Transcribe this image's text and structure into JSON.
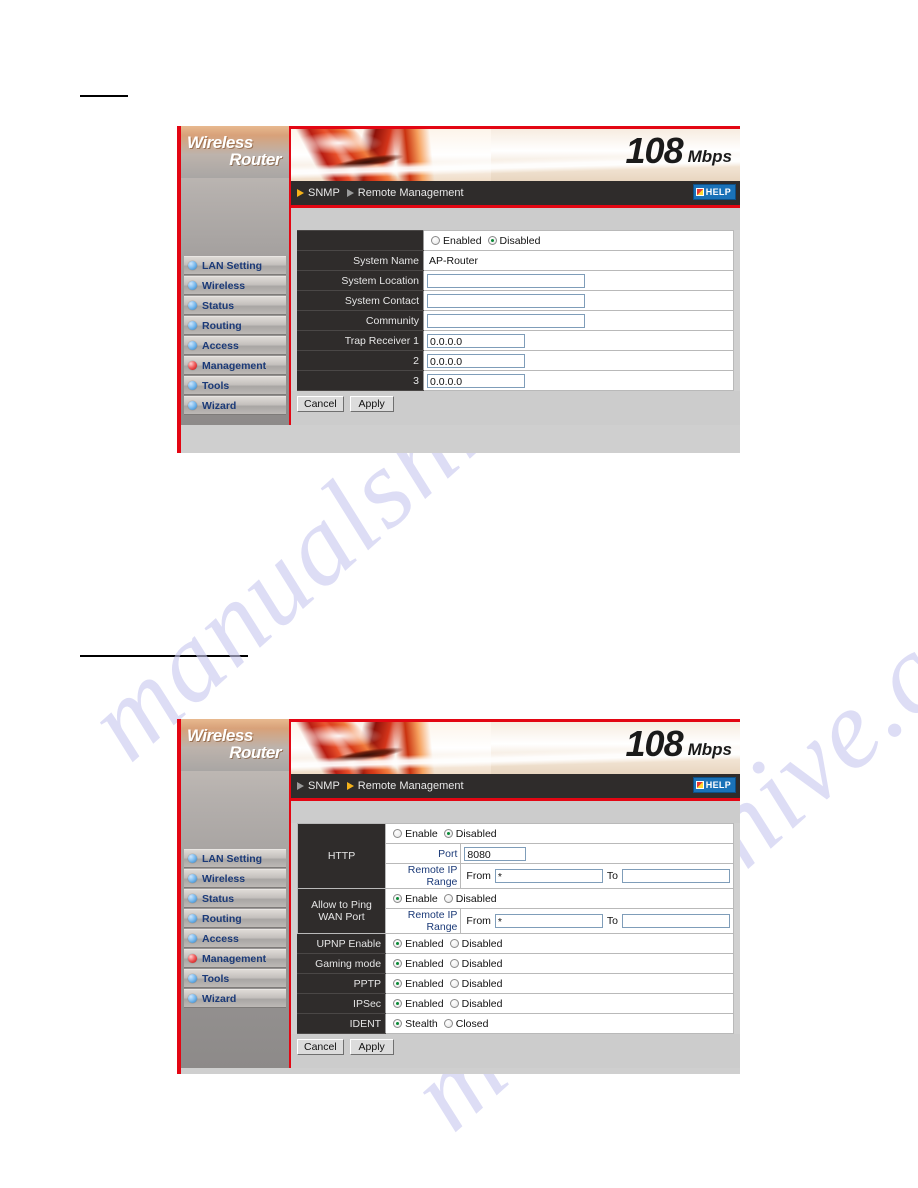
{
  "watermark": {
    "text": "manualshive.com"
  },
  "panels": [
    {
      "brand": {
        "line1": "Wireless",
        "line2": "Router"
      },
      "logo": {
        "number": "108",
        "unit": "Mbps"
      },
      "breadcrumb": {
        "item1": "SNMP",
        "item2": "Remote Management",
        "help_label": "HELP"
      },
      "menu": [
        {
          "label": "LAN Setting",
          "active": false
        },
        {
          "label": "Wireless",
          "active": false
        },
        {
          "label": "Status",
          "active": false
        },
        {
          "label": "Routing",
          "active": false
        },
        {
          "label": "Access",
          "active": false
        },
        {
          "label": "Management",
          "active": true
        },
        {
          "label": "Tools",
          "active": false
        },
        {
          "label": "Wizard",
          "active": false
        }
      ],
      "form": {
        "enable_row": {
          "option_on": "Enabled",
          "option_off": "Disabled",
          "selected": "Disabled"
        },
        "system_name": {
          "label": "System Name",
          "value": "AP-Router"
        },
        "system_location": {
          "label": "System Location",
          "value": ""
        },
        "system_contact": {
          "label": "System Contact",
          "value": ""
        },
        "community": {
          "label": "Community",
          "value": ""
        },
        "trap1": {
          "label": "Trap Receiver 1",
          "value": "0.0.0.0"
        },
        "trap2": {
          "label": "2",
          "value": "0.0.0.0"
        },
        "trap3": {
          "label": "3",
          "value": "0.0.0.0"
        }
      },
      "buttons": {
        "cancel": "Cancel",
        "apply": "Apply"
      }
    },
    {
      "brand": {
        "line1": "Wireless",
        "line2": "Router"
      },
      "logo": {
        "number": "108",
        "unit": "Mbps"
      },
      "breadcrumb": {
        "item1": "SNMP",
        "item2": "Remote Management",
        "help_label": "HELP"
      },
      "menu": [
        {
          "label": "LAN Setting",
          "active": false
        },
        {
          "label": "Wireless",
          "active": false
        },
        {
          "label": "Status",
          "active": false
        },
        {
          "label": "Routing",
          "active": false
        },
        {
          "label": "Access",
          "active": false
        },
        {
          "label": "Management",
          "active": true
        },
        {
          "label": "Tools",
          "active": false
        },
        {
          "label": "Wizard",
          "active": false
        }
      ],
      "form": {
        "http": {
          "label": "HTTP",
          "enable_on": "Enable",
          "enable_off": "Disabled",
          "selected": "Disabled",
          "port_label": "Port",
          "port_value": "8080",
          "range_label": "Remote IP Range",
          "from_label": "From",
          "from_value": "*",
          "to_label": "To",
          "to_value": ""
        },
        "ping_wan": {
          "label": "Allow to Ping WAN Port",
          "enable_on": "Enable",
          "enable_off": "Disabled",
          "selected": "Enable",
          "range_label": "Remote IP Range",
          "from_label": "From",
          "from_value": "*",
          "to_label": "To",
          "to_value": ""
        },
        "upnp": {
          "label": "UPNP Enable",
          "option_on": "Enabled",
          "option_off": "Disabled",
          "selected": "Enabled"
        },
        "gaming": {
          "label": "Gaming mode",
          "option_on": "Enabled",
          "option_off": "Disabled",
          "selected": "Enabled"
        },
        "pptp": {
          "label": "PPTP",
          "option_on": "Enabled",
          "option_off": "Disabled",
          "selected": "Enabled"
        },
        "ipsec": {
          "label": "IPSec",
          "option_on": "Enabled",
          "option_off": "Disabled",
          "selected": "Enabled"
        },
        "ident": {
          "label": "IDENT",
          "option_on": "Stealth",
          "option_off": "Closed",
          "selected": "Stealth"
        }
      },
      "buttons": {
        "cancel": "Cancel",
        "apply": "Apply"
      }
    }
  ]
}
